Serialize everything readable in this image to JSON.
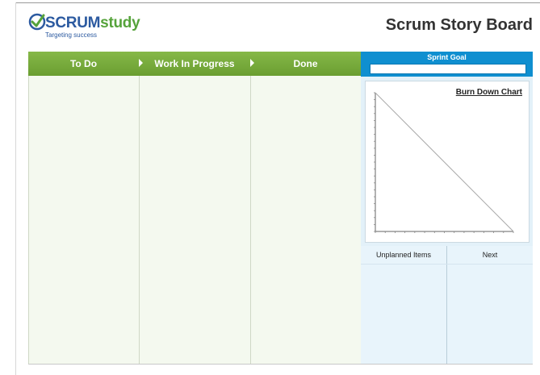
{
  "logo": {
    "brand_part1": "SCRUM",
    "brand_part2": "study",
    "tagline": "Targeting success",
    "icon": "checkmark-circle-icon"
  },
  "title": "Scrum Story Board",
  "columns": [
    {
      "label": "To Do"
    },
    {
      "label": "Work In Progress"
    },
    {
      "label": "Done"
    }
  ],
  "sprint_goal": {
    "label": "Sprint Goal",
    "value": ""
  },
  "burndown": {
    "title": "Burn Down Chart",
    "chart_data": {
      "type": "line",
      "title": "Burn Down Chart",
      "x": [
        0,
        1
      ],
      "series": [
        {
          "values": [
            1,
            0
          ]
        }
      ],
      "xlim": [
        0,
        1
      ],
      "ylim": [
        0,
        1
      ],
      "y_ticks": 20,
      "x_ticks": 14,
      "grid": false
    }
  },
  "bottom": {
    "unplanned_label": "Unplanned Items",
    "next_label": "Next"
  },
  "colors": {
    "header_green": "#76aa3b",
    "sprint_blue": "#0f8fd0",
    "column_bg": "#f4f9ef",
    "panel_bg": "#e8f4fb"
  }
}
